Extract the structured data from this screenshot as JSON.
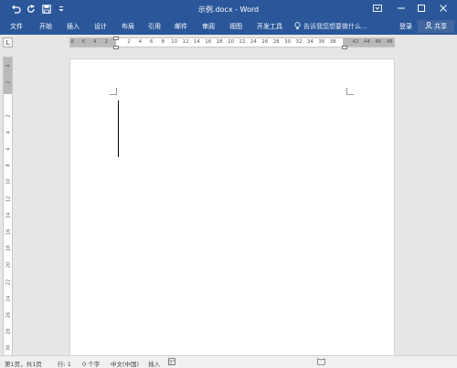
{
  "titlebar": {
    "title": "示例.docx - Word",
    "quick_access": [
      "undo-icon",
      "redo-icon",
      "save-icon",
      "customize-icon"
    ],
    "window_buttons": [
      "ribbon-options-icon",
      "minimize-icon",
      "maximize-icon",
      "close-icon"
    ]
  },
  "ribbon": {
    "tabs": [
      {
        "label": "文件"
      },
      {
        "label": "开始"
      },
      {
        "label": "插入"
      },
      {
        "label": "设计"
      },
      {
        "label": "布局"
      },
      {
        "label": "引用"
      },
      {
        "label": "邮件"
      },
      {
        "label": "审阅"
      },
      {
        "label": "视图"
      },
      {
        "label": "开发工具"
      }
    ],
    "tell_me": "告诉我您想要做什么...",
    "sign_in": "登录",
    "share": "共享"
  },
  "ruler": {
    "tab_selector": "L",
    "h_labels": [
      "8",
      "6",
      "4",
      "2",
      "",
      "2",
      "4",
      "6",
      "8",
      "10",
      "12",
      "14",
      "16",
      "18",
      "20",
      "22",
      "24",
      "26",
      "28",
      "30",
      "32",
      "34",
      "36",
      "38",
      "",
      "42",
      "44",
      "46",
      "48"
    ],
    "v_labels": [
      "4",
      "2",
      "",
      "2",
      "4",
      "6",
      "8",
      "10",
      "12",
      "14",
      "16",
      "18",
      "20",
      "22",
      "24",
      "26",
      "28",
      "30"
    ]
  },
  "statusbar": {
    "page": "第1页，共1页",
    "line": "行: 1",
    "words": "0 个字",
    "language": "中文(中国)",
    "mode": "插入"
  },
  "colors": {
    "accent": "#2b579a",
    "share_bg": "#41659e",
    "workspace": "#e6e6e6",
    "page": "#ffffff"
  }
}
